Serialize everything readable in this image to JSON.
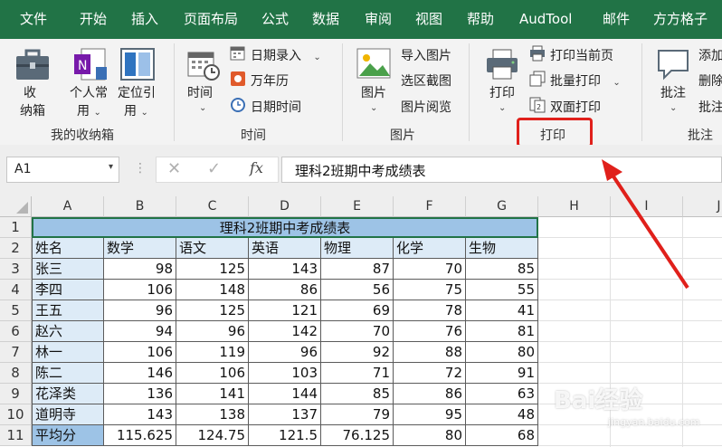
{
  "menu": {
    "items": [
      "文件",
      "开始",
      "插入",
      "页面布局",
      "公式",
      "数据",
      "审阅",
      "视图",
      "帮助",
      "AudTool",
      "邮件",
      "方方格子"
    ]
  },
  "ribbon": {
    "groups": {
      "my_box": {
        "label": "我的收纳箱",
        "btn1": [
          "收",
          "纳箱"
        ],
        "btn2": [
          "个人常",
          "用"
        ],
        "btn3": [
          "定位引",
          "用"
        ]
      },
      "time": {
        "label": "时间",
        "time_btn": "时间",
        "date_entry": "日期录入",
        "perpetual_calendar": "万年历",
        "datetime": "日期时间"
      },
      "picture": {
        "label": "图片",
        "picture_btn": "图片",
        "import_picture": "导入图片",
        "select_screenshot": "选区截图",
        "picture_browse": "图片阅览"
      },
      "print": {
        "label": "打印",
        "print_btn": "打印",
        "print_current_page": "打印当前页",
        "batch_print": "批量打印",
        "duplex_print": "双面打印"
      },
      "comment": {
        "label": "批注",
        "comment_btn": "批注",
        "add": "添加",
        "delete": "删除",
        "batch": "批注"
      }
    }
  },
  "formula_bar": {
    "name_box": "A1",
    "fx": "fx",
    "formula": "理科2班期中考成绩表"
  },
  "sheet": {
    "columns": [
      "A",
      "B",
      "C",
      "D",
      "E",
      "F",
      "G",
      "H",
      "I",
      "J"
    ],
    "row_numbers": [
      "1",
      "2",
      "3",
      "4",
      "5",
      "6",
      "7",
      "8",
      "9",
      "10",
      "11"
    ],
    "title": "理科2班期中考成绩表",
    "headers": [
      "姓名",
      "数学",
      "语文",
      "英语",
      "物理",
      "化学",
      "生物"
    ],
    "rows": [
      [
        "张三",
        "98",
        "125",
        "143",
        "87",
        "70",
        "85"
      ],
      [
        "李四",
        "106",
        "148",
        "86",
        "56",
        "75",
        "55"
      ],
      [
        "王五",
        "96",
        "125",
        "121",
        "69",
        "78",
        "41"
      ],
      [
        "赵六",
        "94",
        "96",
        "142",
        "70",
        "76",
        "81"
      ],
      [
        "林一",
        "106",
        "119",
        "96",
        "92",
        "88",
        "80"
      ],
      [
        "陈二",
        "146",
        "106",
        "103",
        "71",
        "72",
        "91"
      ],
      [
        "花泽类",
        "136",
        "141",
        "144",
        "85",
        "86",
        "63"
      ],
      [
        "道明寺",
        "143",
        "138",
        "137",
        "79",
        "95",
        "48"
      ],
      [
        "平均分",
        "115.625",
        "124.75",
        "121.5",
        "76.125",
        "80",
        "68"
      ]
    ]
  },
  "watermark": {
    "brand": "Bai经验",
    "url": "jingyan.baidu.com"
  },
  "colors": {
    "accent_green": "#217346",
    "title_fill": "#9dc3e6",
    "header_fill": "#ddebf7",
    "highlight_red": "#e0201b"
  }
}
